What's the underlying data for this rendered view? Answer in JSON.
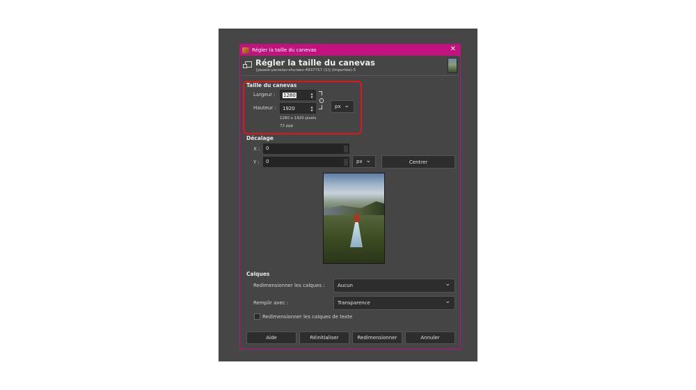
{
  "window": {
    "title": "Régler la taille du canevas",
    "close_glyph": "✕"
  },
  "header": {
    "title": "Régler la taille du canevas",
    "subtitle": "[pexels-yaroslav-shuraev-4937757 (1)] (importée)-5",
    "icon": "canvas-size-icon"
  },
  "canvas_size": {
    "section_label": "Taille du canevas",
    "width_label": "Largeur :",
    "width_value": "1280",
    "height_label": "Hauteur :",
    "height_value": "1920",
    "unit": "px",
    "pixels_info": "1280 x 1920 pixels",
    "ppi_info": "72 ppp"
  },
  "offset": {
    "section_label": "Décalage",
    "x_label": "X :",
    "x_value": "0",
    "y_label": "Y :",
    "y_value": "0",
    "unit": "px",
    "center_button": "Centrer"
  },
  "layers": {
    "section_label": "Calques",
    "resize_label": "Redimensionner les calques :",
    "resize_value": "Aucun",
    "fill_label": "Remplir avec :",
    "fill_value": "Transparence",
    "text_layers_checkbox": "Redimensionner les calques de texte",
    "text_layers_checked": false
  },
  "buttons": {
    "help": "Aide",
    "reset": "Réinitialiser",
    "resize": "Redimensionner",
    "cancel": "Annuler"
  },
  "colors": {
    "titlebar": "#c2127f",
    "highlight": "#e2151f",
    "dialog_bg": "#454545"
  }
}
